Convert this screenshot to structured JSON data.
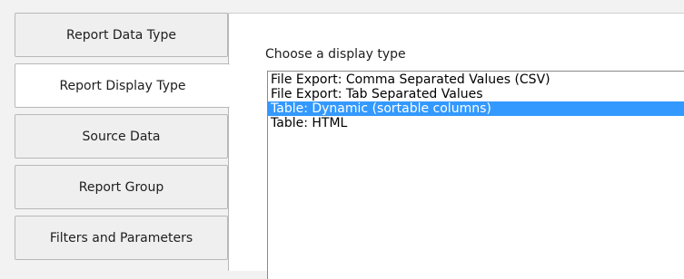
{
  "tabs": [
    {
      "label": "Report Data Type",
      "active": false
    },
    {
      "label": "Report Display Type",
      "active": true
    },
    {
      "label": "Source Data",
      "active": false
    },
    {
      "label": "Report Group",
      "active": false
    },
    {
      "label": "Filters and Parameters",
      "active": false
    }
  ],
  "panel": {
    "label": "Choose a display type",
    "options": [
      {
        "label": "File Export: Comma Separated Values (CSV)",
        "selected": false
      },
      {
        "label": "File Export: Tab Separated Values",
        "selected": false
      },
      {
        "label": "Table: Dynamic (sortable columns)",
        "selected": true
      },
      {
        "label": "Table: HTML",
        "selected": false
      }
    ]
  },
  "colors": {
    "selection": "#3399ff",
    "selection_text": "#ffffff"
  }
}
